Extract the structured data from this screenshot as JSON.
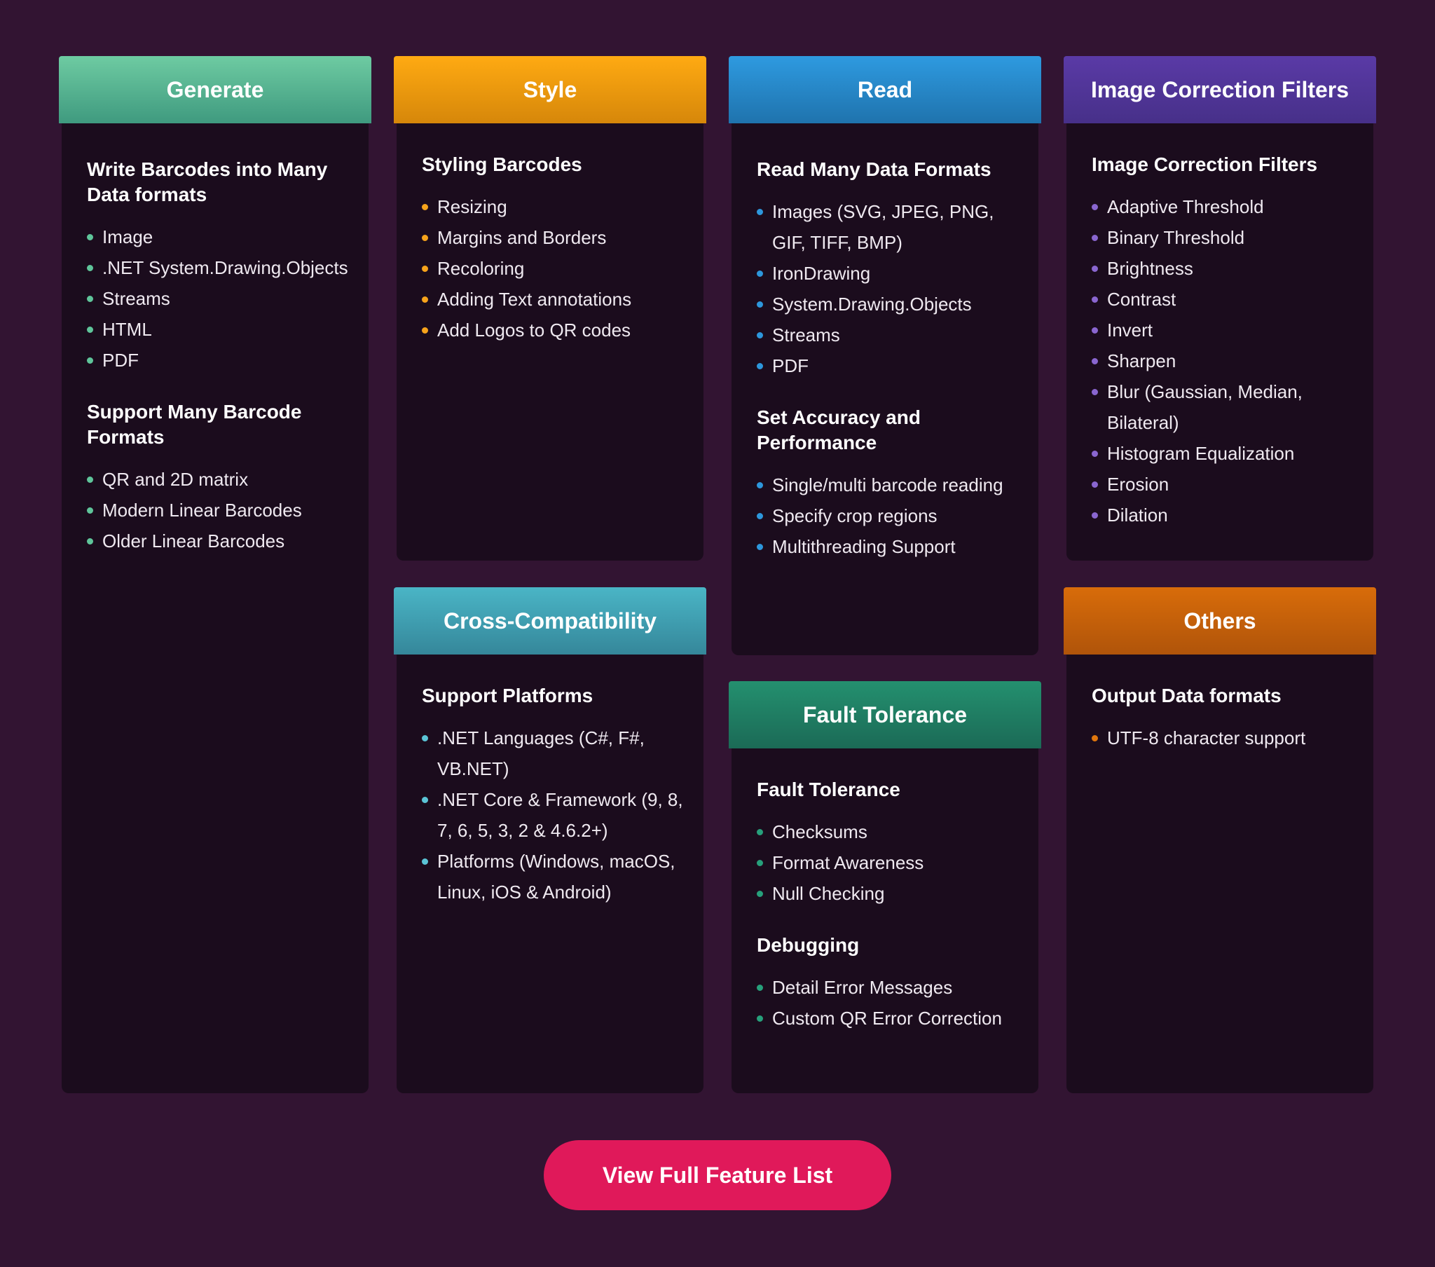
{
  "colors": {
    "background": "#321432",
    "card_background": "#1b0c1d",
    "cta_background": "#e0195a"
  },
  "cards": {
    "generate": {
      "header": "Generate",
      "header_colors": [
        "#6ecba2",
        "#3f9a7f"
      ],
      "dot_color": "#5fc59a",
      "sections": [
        {
          "title": "Write Barcodes into Many Data formats",
          "items": [
            "Image",
            ".NET System.Drawing.Objects",
            "Streams",
            "HTML",
            "PDF"
          ]
        },
        {
          "title": "Support Many Barcode Formats",
          "items": [
            "QR and 2D matrix",
            "Modern Linear Barcodes",
            "Older Linear Barcodes"
          ]
        }
      ]
    },
    "style": {
      "header": "Style",
      "header_colors": [
        "#ffaa12",
        "#d6870a"
      ],
      "dot_color": "#f7a31b",
      "sections": [
        {
          "title": "Styling Barcodes",
          "items": [
            "Resizing",
            "Margins and Borders",
            "Recoloring",
            "Adding Text annotations",
            "Add Logos to QR codes"
          ]
        }
      ]
    },
    "read": {
      "header": "Read",
      "header_colors": [
        "#2e9ae0",
        "#1f73ad"
      ],
      "dot_color": "#2d97dc",
      "sections": [
        {
          "title": "Read Many Data Formats",
          "items": [
            "Images (SVG, JPEG, PNG, GIF, TIFF, BMP)",
            "IronDrawing",
            "System.Drawing.Objects",
            "Streams",
            "PDF"
          ]
        },
        {
          "title": "Set Accuracy and Performance",
          "items": [
            "Single/multi barcode reading",
            "Specify crop regions",
            "Multithreading Support"
          ]
        }
      ]
    },
    "image_filters": {
      "header": "Image Correction Filters",
      "header_colors": [
        "#5a3aa6",
        "#473089"
      ],
      "dot_color": "#8a66d0",
      "sections": [
        {
          "title": "Image Correction Filters",
          "items": [
            "Adaptive Threshold",
            "Binary Threshold",
            "Brightness",
            "Contrast",
            "Invert",
            "Sharpen",
            "Blur (Gaussian, Median, Bilateral)",
            "Histogram Equalization",
            "Erosion",
            "Dilation"
          ]
        }
      ]
    },
    "cross_compat": {
      "header": "Cross-Compatibility",
      "header_colors": [
        "#4ab5c6",
        "#35879a"
      ],
      "dot_color": "#5bc4d6",
      "sections": [
        {
          "title": "Support Platforms",
          "items": [
            ".NET Languages (C#, F#, VB.NET)",
            ".NET Core & Framework (9, 8, 7, 6, 5, 3, 2 & 4.6.2+)",
            "Platforms (Windows, macOS, Linux, iOS & Android)"
          ]
        }
      ]
    },
    "fault_tolerance": {
      "header": "Fault Tolerance",
      "header_colors": [
        "#24906f",
        "#1b6a56"
      ],
      "dot_color": "#27a07b",
      "sections": [
        {
          "title": "Fault Tolerance",
          "items": [
            "Checksums",
            "Format Awareness",
            "Null Checking"
          ]
        },
        {
          "title": "Debugging",
          "items": [
            "Detail Error Messages",
            "Custom QR Error Correction"
          ]
        }
      ]
    },
    "others": {
      "header": "Others",
      "header_colors": [
        "#d86c0a",
        "#b0540a"
      ],
      "dot_color": "#e0760d",
      "sections": [
        {
          "title": "Output Data formats",
          "items": [
            "UTF-8 character support"
          ]
        }
      ]
    }
  },
  "cta": {
    "label": "View Full Feature List"
  }
}
